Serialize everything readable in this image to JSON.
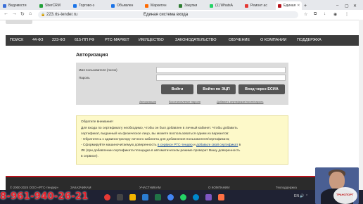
{
  "browser": {
    "tabs": [
      {
        "label": "Ведомости",
        "color": "#3b6fd8"
      },
      {
        "label": "SberCRM",
        "color": "#21a038"
      },
      {
        "label": "Торгово-э",
        "color": "#1a73e8"
      },
      {
        "label": "Объявлен",
        "color": "#1a73e8"
      },
      {
        "label": "Маркетин",
        "color": "#ff6a00"
      },
      {
        "label": "Закупки",
        "color": "#2e7d32"
      },
      {
        "label": "(1) WhatsA",
        "color": "#25d366"
      },
      {
        "label": "Ремонт ас",
        "color": "#e53935"
      },
      {
        "label": "Единая",
        "color": "#b5121b"
      }
    ],
    "new_tab": "+",
    "url": "223.rts-tender.ru",
    "page_title": "Единая система входа"
  },
  "menu": {
    "items": [
      "ПОИСК",
      "44-ФЗ",
      "223-ФЗ",
      "615-ПП РФ",
      "РТС-МАРКЕТ",
      "ИМУЩЕСТВО",
      "ЗАКОНОДАТЕЛЬСТВО",
      "ОБУЧЕНИЕ",
      "О КОМПАНИИ",
      "ПОДДЕРЖКА"
    ]
  },
  "auth": {
    "title": "Авторизация",
    "username_label": "Имя пользователя (логин)",
    "password_label": "Пароль",
    "login_button": "Войти",
    "login_ep_button": "Войти по ЭЦП",
    "esia_button": "Вход через ЕСИА",
    "links": [
      "Авторизация",
      "Восстановление пароля",
      "Добавить сертификат/логин/пароль"
    ]
  },
  "notice": {
    "title": "Обратите внимание!",
    "line1": "Для входа по сертификату необходимо, чтобы он был добавлен в личный кабинет. Чтобы добавить",
    "line2": "сертификат, выданный на физическое лицо, вы можете воспользоваться одним из вариантов:",
    "line3": "- Обратитесь к администратору личного кабинета для добавления пользователя/сертификата;",
    "line4_pre": "- Сформируйте машиночитаемую доверенность ",
    "line4_link1": "в сервисе РТС-тендер",
    "line4_mid": " и ",
    "line4_link2": "добавьте свой сертификат",
    "line4_post": " в",
    "line5": "ЛК (при добавлении сертификата площадка в автоматическом режиме проверит Вашу доверенность",
    "line6": "в сервисе)."
  },
  "footer": {
    "items": [
      "© 2000-2025 ООО «РТС-тендер»",
      "ЗАКАЗЧИКАМ",
      "УЧАСТНИКАМ",
      "О КОМПАНИИ",
      "Техподдержка"
    ]
  },
  "overlay": {
    "phone": "8-961-940-26-21",
    "cam_logo": "ТРАНСПОРТ"
  },
  "taskbar": {
    "tray": "EN  🔊  ⌃"
  }
}
